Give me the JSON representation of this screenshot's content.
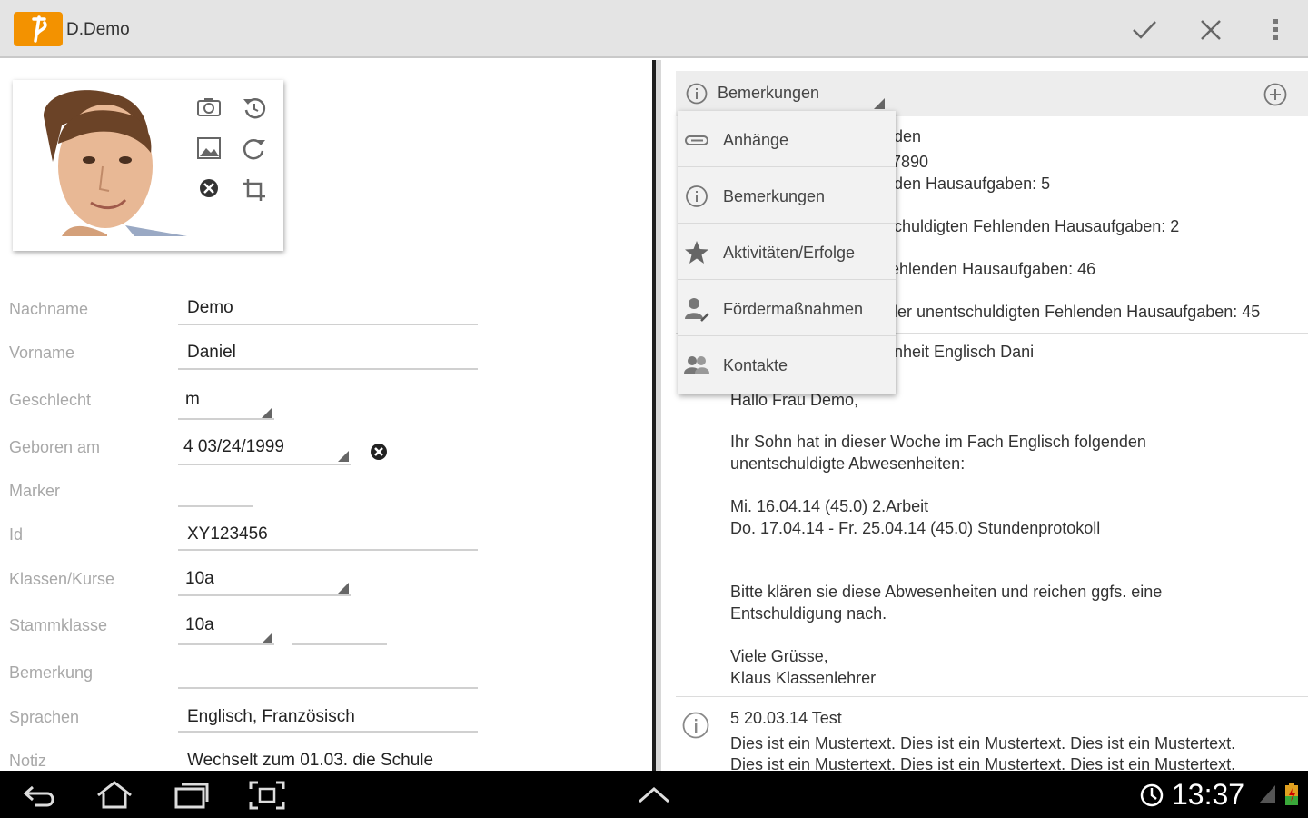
{
  "app": {
    "title": "D.Demo"
  },
  "form": {
    "fields": [
      {
        "label": "Nachname",
        "value": "Demo"
      },
      {
        "label": "Vorname",
        "value": "Daniel"
      },
      {
        "label": "Geschlecht",
        "value": "m"
      },
      {
        "label": "Geboren am",
        "value": "4 03/24/1999"
      },
      {
        "label": "Marker",
        "value": ""
      },
      {
        "label": "Id",
        "value": "XY123456"
      },
      {
        "label": "Klassen/Kurse",
        "value": "10a"
      },
      {
        "label": "Stammklasse",
        "value": "10a"
      },
      {
        "label": "Bemerkung",
        "value": ""
      },
      {
        "label": "Sprachen",
        "value": "Englisch, Französisch"
      },
      {
        "label": "Notiz",
        "value": "Wechselt zum 01.03. die Schule"
      }
    ]
  },
  "right": {
    "selector_label": "Bemerkungen",
    "partial_lines": [
      "den",
      "7890",
      "den Hausaufgaben: 5",
      "chuldigten  Fehlenden Hausaufgaben: 2",
      "ehlenden Hausaufgaben: 46",
      "ler unentschuldigten  Fehlenden Hausaufgaben: 45",
      "nheit Englisch Dani"
    ],
    "message_lines": [
      "Hallo Frau Demo,",
      "Ihr Sohn hat in dieser Woche im Fach Englisch folgenden",
      "unentschuldigte Abwesenheiten:",
      "Mi. 16.04.14  (45.0)  2.Arbeit",
      "Do. 17.04.14 - Fr. 25.04.14  (45.0)  Stundenprotokoll",
      "Bitte klären sie diese Abwesenheiten und reichen ggfs. eine",
      "Entschuldigung nach.",
      "Viele Grüsse,",
      "Klaus Klassenlehrer"
    ],
    "entry_title": "5 20.03.14  Test",
    "entry_lines": [
      "Dies ist ein Mustertext. Dies ist ein Mustertext. Dies ist ein Mustertext.",
      "Dies ist ein Mustertext. Dies ist ein Mustertext. Dies ist ein Mustertext."
    ]
  },
  "dropdown": {
    "items": [
      {
        "label": "Anhänge",
        "icon": "paperclip-icon"
      },
      {
        "label": "Bemerkungen",
        "icon": "info-icon"
      },
      {
        "label": "Aktivitäten/Erfolge",
        "icon": "star-icon"
      },
      {
        "label": "Fördermaßnahmen",
        "icon": "person-edit-icon"
      },
      {
        "label": "Kontakte",
        "icon": "contacts-icon"
      }
    ]
  },
  "system": {
    "clock": "13:37"
  },
  "colors": {
    "accent": "#f39200",
    "actionbar": "#e4e4e4",
    "navbar": "#000000"
  }
}
